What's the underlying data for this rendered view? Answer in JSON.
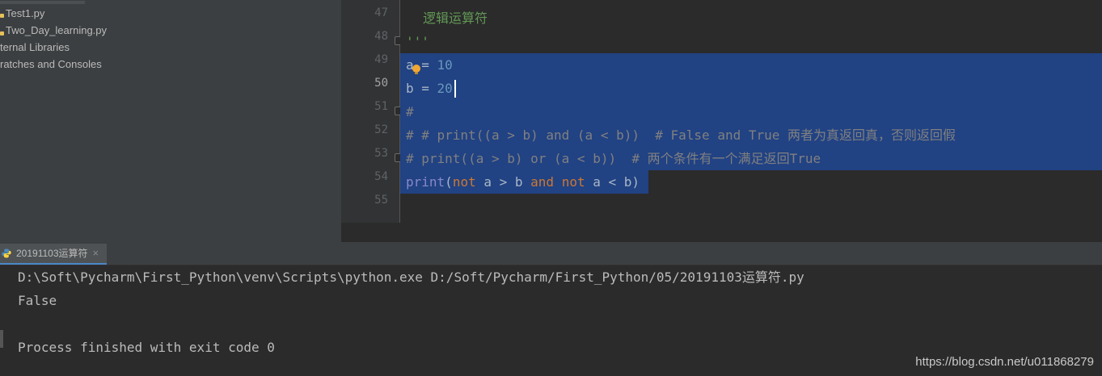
{
  "project_tree": {
    "items": [
      {
        "label": "Test1.py",
        "type": "python-file"
      },
      {
        "label": "Two_Day_learning.py",
        "type": "python-file"
      },
      {
        "label": "ternal Libraries",
        "type": "library"
      },
      {
        "label": "ratches and Consoles",
        "type": "scratches"
      }
    ]
  },
  "editor": {
    "line_numbers": [
      "47",
      "48",
      "49",
      "50",
      "51",
      "52",
      "53",
      "54",
      "55"
    ],
    "current_line": "50",
    "lines": {
      "l47": {
        "doc": "逻辑运算符"
      },
      "l48": {
        "doc": "'''"
      },
      "l49": {
        "var": "a",
        "eq": " = ",
        "num": "10"
      },
      "l50": {
        "var": "b",
        "eq": " = ",
        "num": "20"
      },
      "l51": {
        "comment": "#"
      },
      "l52": {
        "comment": "# # print((a > b) and (a < b))  # False and True 两者为真返回真，否则返回假"
      },
      "l53": {
        "comment": "# print((a > b) or (a < b))  # 两个条件有一个满足返回True"
      },
      "l54": {
        "fn": "print",
        "p1": "(",
        "kw1": "not",
        "m1": " a > b ",
        "kw2": "and",
        "sp": " ",
        "kw3": "not",
        "m2": " a < b)"
      },
      "l55": {}
    }
  },
  "run_panel": {
    "tab_label": "20191103运算符",
    "close_glyph": "×",
    "console_lines": [
      "D:\\Soft\\Pycharm\\First_Python\\venv\\Scripts\\python.exe D:/Soft/Pycharm/First_Python/05/20191103运算符.py",
      "False",
      "",
      "Process finished with exit code 0"
    ]
  },
  "watermark": "https://blog.csdn.net/u011868279",
  "colors": {
    "background": "#2b2b2b",
    "selection": "#214283",
    "keyword": "#cc7832",
    "number": "#6897bb",
    "comment": "#808080",
    "docstring": "#629755",
    "builtin": "#8888c6"
  }
}
